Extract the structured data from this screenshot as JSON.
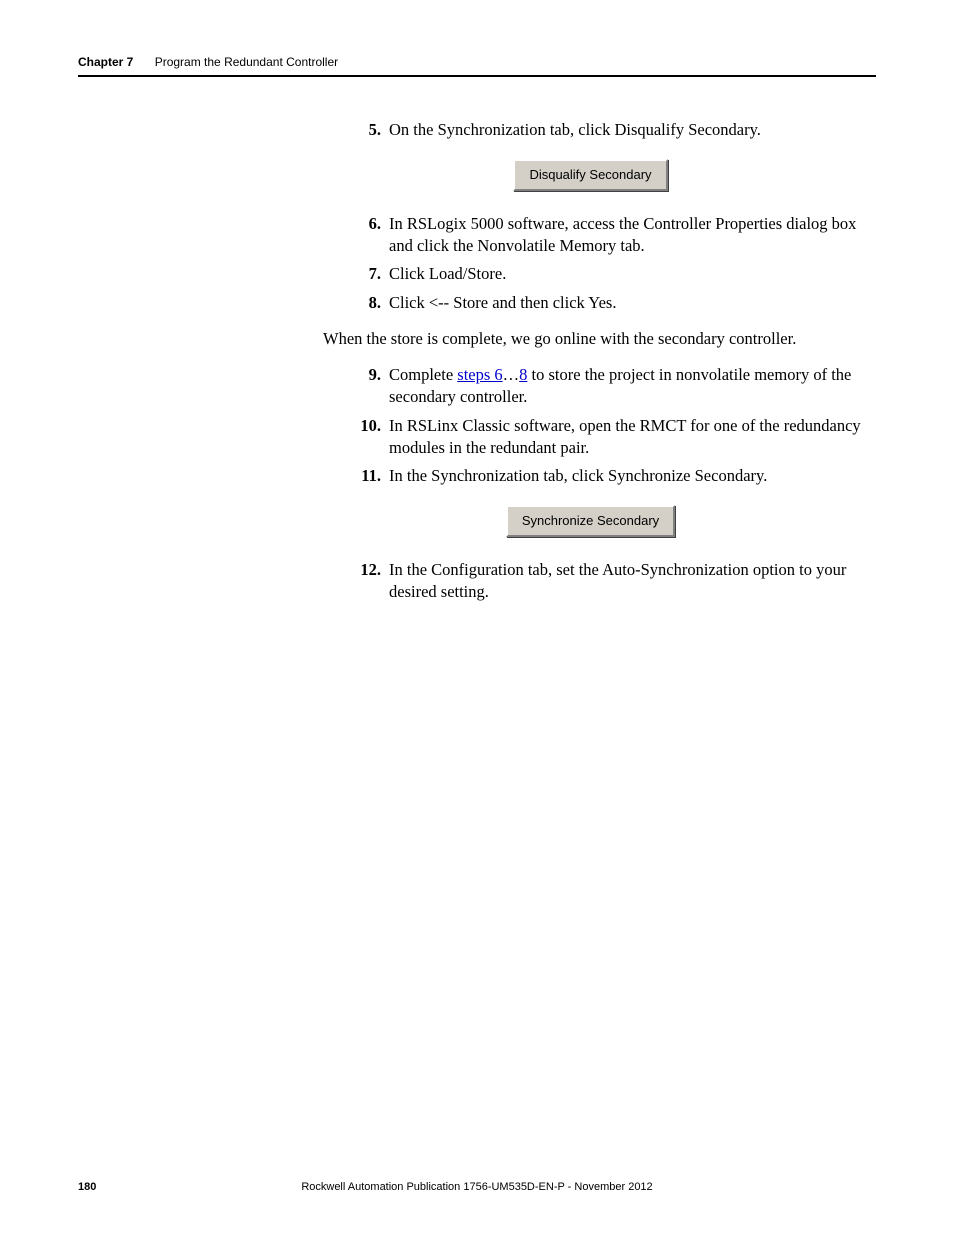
{
  "header": {
    "chapter_label": "Chapter 7",
    "chapter_title": "Program the Redundant Controller"
  },
  "steps": {
    "s5": {
      "num": "5.",
      "text": "On the Synchronization tab, click Disqualify Secondary."
    },
    "s6": {
      "num": "6.",
      "text": "In RSLogix 5000 software, access the Controller Properties dialog box and click the Nonvolatile Memory tab."
    },
    "s7": {
      "num": "7.",
      "text": "Click Load/Store."
    },
    "s8": {
      "num": "8.",
      "text": "Click <-- Store and then click Yes."
    },
    "para_after_8": "When the store is complete, we go online with the secondary controller.",
    "s9": {
      "num": "9.",
      "pre": "Complete ",
      "link1": "steps 6",
      "mid": "…",
      "link2": "8",
      "post": " to store the project in nonvolatile memory of the secondary controller."
    },
    "s10": {
      "num": "10.",
      "text": "In RSLinx Classic software, open the RMCT for one of the redundancy modules in the redundant pair."
    },
    "s11": {
      "num": "11.",
      "text": "In the Synchronization tab, click Synchronize Secondary."
    },
    "s12": {
      "num": "12.",
      "text": "In the Configuration tab, set the Auto-Synchronization option to your desired setting."
    }
  },
  "buttons": {
    "disqualify": "Disqualify Secondary",
    "synchronize": "Synchronize Secondary"
  },
  "footer": {
    "page_number": "180",
    "publication": "Rockwell Automation Publication 1756-UM535D-EN-P - November 2012"
  }
}
